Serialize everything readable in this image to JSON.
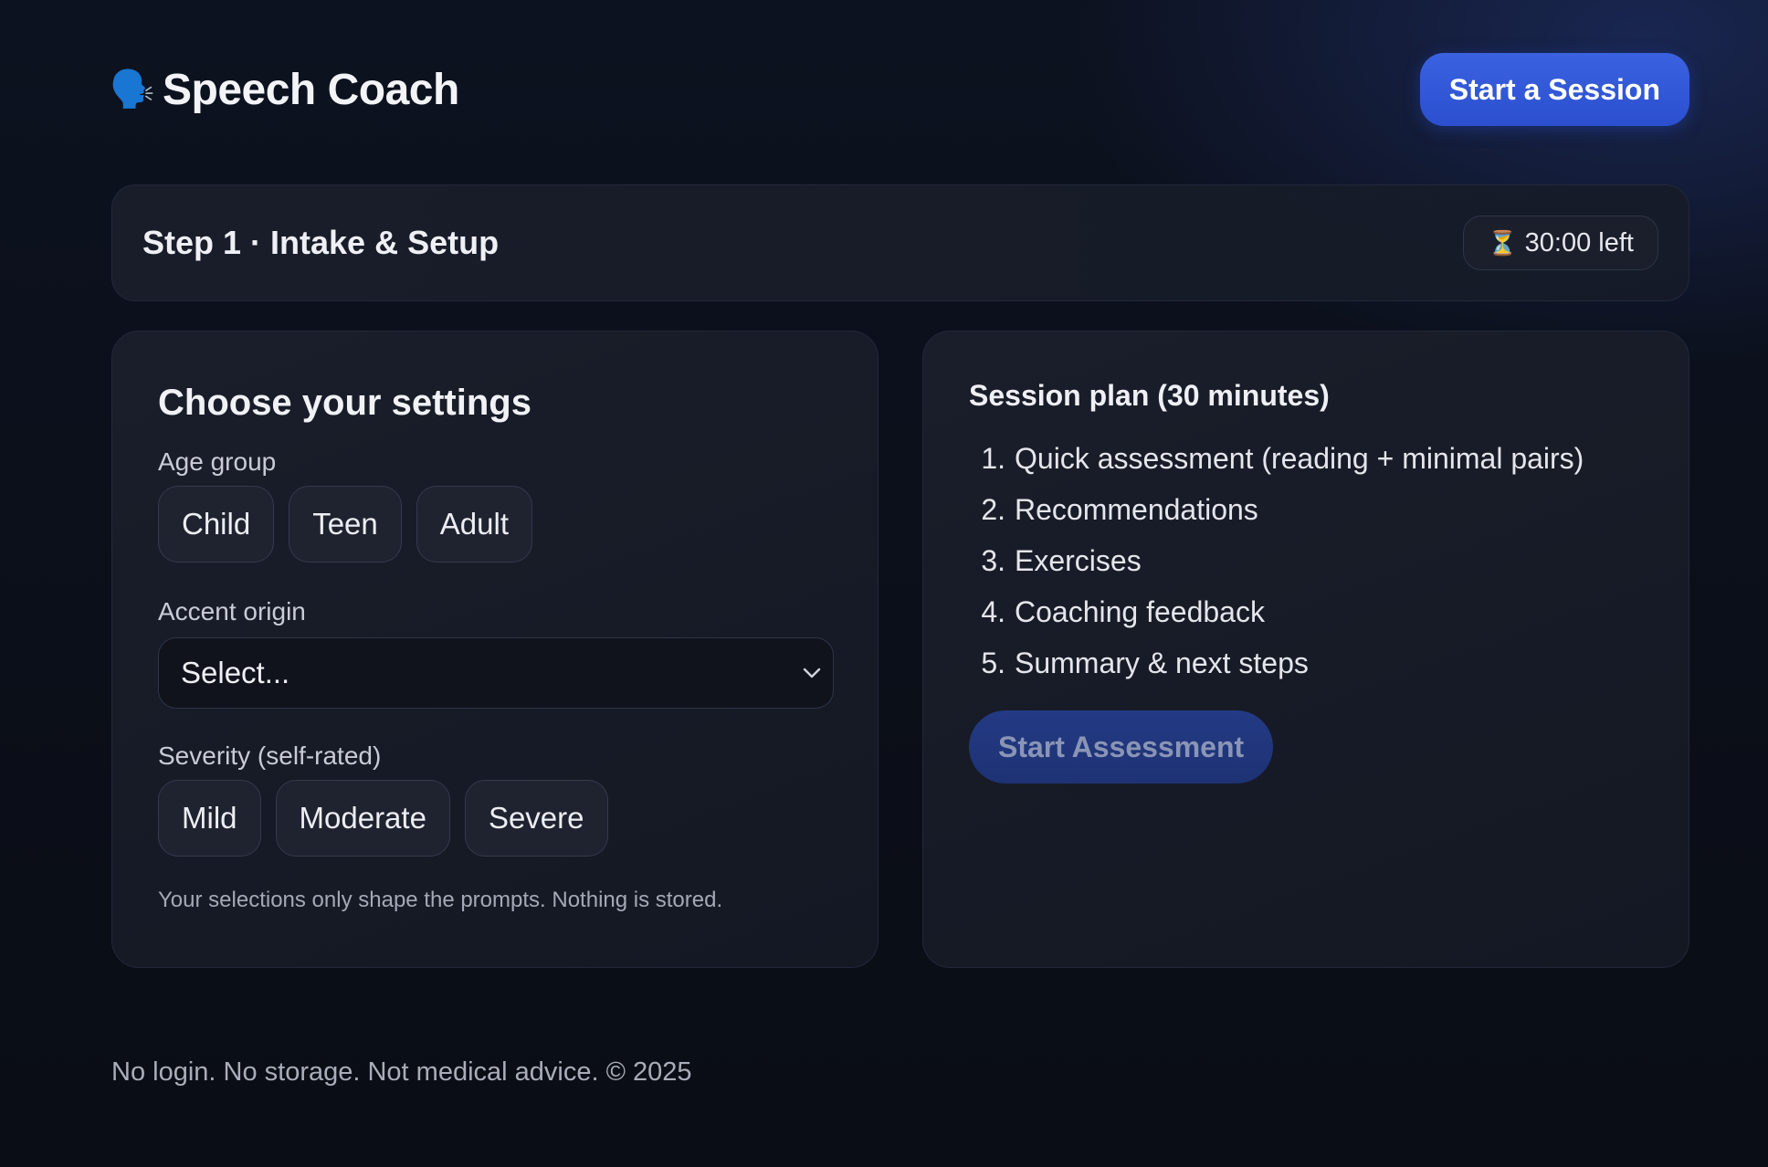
{
  "header": {
    "icon": "speaking-head-icon",
    "icon_glyph": "🗣️",
    "title": "Speech Coach",
    "start_session_label": "Start a Session"
  },
  "stepbar": {
    "title": "Step 1 · Intake & Setup",
    "timer_icon": "hourglass-icon",
    "timer_glyph": "⏳",
    "timer_text": "30:00 left"
  },
  "settings": {
    "title": "Choose your settings",
    "age_label": "Age group",
    "age_options": [
      "Child",
      "Teen",
      "Adult"
    ],
    "accent_label": "Accent origin",
    "accent_value": "Select...",
    "severity_label": "Severity (self-rated)",
    "severity_options": [
      "Mild",
      "Moderate",
      "Severe"
    ],
    "note": "Your selections only shape the prompts. Nothing is stored."
  },
  "plan": {
    "title": "Session plan (30 minutes)",
    "steps": [
      {
        "num": "1.",
        "text": "Quick assessment (reading + minimal pairs)"
      },
      {
        "num": "2.",
        "text": "Recommendations"
      },
      {
        "num": "3.",
        "text": "Exercises"
      },
      {
        "num": "4.",
        "text": "Coaching feedback"
      },
      {
        "num": "5.",
        "text": "Summary & next steps"
      }
    ],
    "start_assessment_label": "Start Assessment"
  },
  "footer": {
    "text": "No login. No storage. Not medical advice. © 2025"
  },
  "colors": {
    "accent": "#2f56d6",
    "background": "#0b0f19",
    "panel": "#171b26"
  }
}
